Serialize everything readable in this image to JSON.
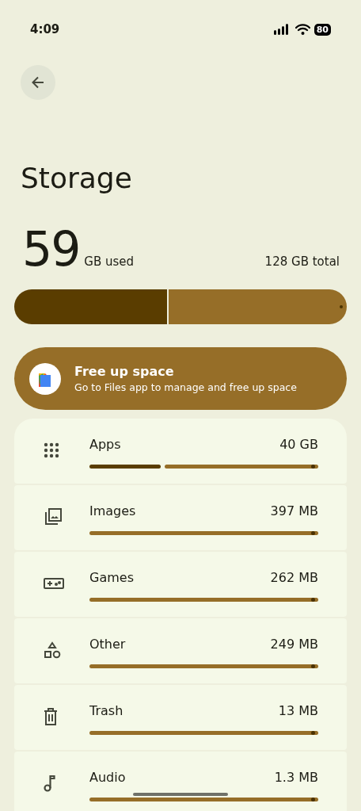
{
  "status_bar": {
    "time": "4:09",
    "battery": "80"
  },
  "title": "Storage",
  "summary": {
    "used": "59",
    "used_unit": "GB used",
    "total": "128 GB total",
    "level": 0.46
  },
  "free_up": {
    "title": "Free up space",
    "subtitle": "Go to Files app to manage and free up space"
  },
  "categories": [
    {
      "kind": "apps",
      "label": "Apps",
      "size": "40 GB",
      "level": 0.31
    },
    {
      "kind": "images",
      "label": "Images",
      "size": "397 MB",
      "level": 0
    },
    {
      "kind": "games",
      "label": "Games",
      "size": "262 MB",
      "level": 0
    },
    {
      "kind": "other",
      "label": "Other",
      "size": "249 MB",
      "level": 0
    },
    {
      "kind": "trash",
      "label": "Trash",
      "size": "13 MB",
      "level": 0
    },
    {
      "kind": "audio",
      "label": "Audio",
      "size": "1.3 MB",
      "level": 0
    }
  ]
}
